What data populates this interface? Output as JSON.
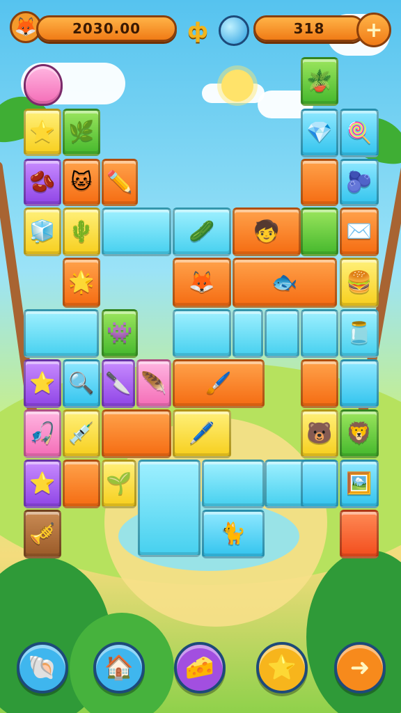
{
  "hud": {
    "score": "2030.00",
    "coins": "318",
    "plus_label": "+",
    "center_symbol": "ф"
  },
  "board": {
    "tiles": [
      {
        "name": "tile-egg",
        "color": "c-pink",
        "icon": "🥚"
      },
      {
        "name": "tile-star",
        "color": "c-yellow",
        "icon": "⭐"
      },
      {
        "name": "tile-leaf",
        "color": "c-green",
        "icon": "🌿"
      },
      {
        "name": "tile-bean",
        "color": "c-purple",
        "icon": "🫘"
      },
      {
        "name": "tile-cat",
        "color": "c-orange",
        "icon": "🐱"
      },
      {
        "name": "tile-pencil",
        "color": "c-orange",
        "icon": "✏️"
      },
      {
        "name": "tile-ice",
        "color": "c-yellow",
        "icon": "🧊"
      },
      {
        "name": "tile-cactus",
        "color": "c-yellow",
        "icon": "🌵"
      },
      {
        "name": "tile-empty",
        "color": "c-cyan",
        "icon": ""
      },
      {
        "name": "tile-pickle",
        "color": "c-cyan",
        "icon": "🥒"
      },
      {
        "name": "tile-kids",
        "color": "c-orange",
        "icon": "🧒"
      },
      {
        "name": "tile-blob",
        "color": "c-blue",
        "icon": "🫐"
      },
      {
        "name": "tile-star-pink",
        "color": "c-orange",
        "icon": "🌟"
      },
      {
        "name": "tile-fox",
        "color": "c-orange",
        "icon": "🦊"
      },
      {
        "name": "tile-fish",
        "color": "c-orange",
        "icon": "🐟"
      },
      {
        "name": "tile-cyan-wide",
        "color": "c-cyan",
        "icon": ""
      },
      {
        "name": "tile-monster",
        "color": "c-green",
        "icon": "👾"
      },
      {
        "name": "tile-jar",
        "color": "c-cyan",
        "icon": "🫙"
      },
      {
        "name": "tile-star-yellow",
        "color": "c-purple",
        "icon": "⭐"
      },
      {
        "name": "tile-magnifier",
        "color": "c-blue",
        "icon": "🔍"
      },
      {
        "name": "tile-knife",
        "color": "c-purple",
        "icon": "🔪"
      },
      {
        "name": "tile-feather",
        "color": "c-pink",
        "icon": "🪶"
      },
      {
        "name": "tile-brush",
        "color": "c-orange",
        "icon": "🖌️"
      },
      {
        "name": "tile-orange-block",
        "color": "c-orange",
        "icon": ""
      },
      {
        "name": "tile-blue-block",
        "color": "c-blue",
        "icon": ""
      },
      {
        "name": "tile-hook",
        "color": "c-pink",
        "icon": "🎣"
      },
      {
        "name": "tile-syringe",
        "color": "c-yellow",
        "icon": "💉"
      },
      {
        "name": "tile-orange-wide",
        "color": "c-orange",
        "icon": ""
      },
      {
        "name": "tile-pen",
        "color": "c-yellow",
        "icon": "🖊️"
      },
      {
        "name": "tile-bear",
        "color": "c-yellow",
        "icon": "🐻"
      },
      {
        "name": "tile-lion",
        "color": "c-green",
        "icon": "🦁"
      },
      {
        "name": "tile-star-small",
        "color": "c-purple",
        "icon": "⭐"
      },
      {
        "name": "tile-orange-small",
        "color": "c-orange",
        "icon": ""
      },
      {
        "name": "tile-leaf-drop",
        "color": "c-yellow",
        "icon": "🌱"
      },
      {
        "name": "tile-ice-big",
        "color": "c-cyan",
        "icon": ""
      },
      {
        "name": "tile-cyan-top",
        "color": "c-cyan",
        "icon": ""
      },
      {
        "name": "tile-cyan-mid",
        "color": "c-cyan",
        "icon": ""
      },
      {
        "name": "tile-kitten",
        "color": "c-blue",
        "icon": "🐈"
      },
      {
        "name": "tile-frame",
        "color": "c-blue",
        "icon": "🖼️"
      },
      {
        "name": "tile-trumpet",
        "color": "c-brown",
        "icon": "🎺"
      },
      {
        "name": "tile-red",
        "color": "c-red",
        "icon": ""
      },
      {
        "name": "tile-plant",
        "color": "c-green",
        "icon": "🪴"
      },
      {
        "name": "tile-lollipop",
        "color": "c-blue",
        "icon": "🍭"
      },
      {
        "name": "tile-gem",
        "color": "c-blue",
        "icon": "💎"
      },
      {
        "name": "tile-ball",
        "color": "c-purple",
        "icon": "🔵"
      },
      {
        "name": "tile-envelope",
        "color": "c-orange",
        "icon": "✉️"
      },
      {
        "name": "tile-burger",
        "color": "c-yellow",
        "icon": "🍔"
      }
    ]
  },
  "buttons": [
    {
      "name": "shell-button",
      "icon": "🐚",
      "color": "#3fb6ee"
    },
    {
      "name": "house-button",
      "icon": "🏠",
      "color": "#3fb6ee"
    },
    {
      "name": "cheese-button",
      "icon": "🧀",
      "color": "#a24fe0"
    },
    {
      "name": "star-button",
      "icon": "⭐",
      "color": "#f7b51c"
    },
    {
      "name": "next-button",
      "icon": "➜",
      "color": "#f78a1c"
    }
  ],
  "colors": {
    "accent": "#f07b16",
    "sky": "#56c3ef",
    "grass": "#8fd14b"
  }
}
